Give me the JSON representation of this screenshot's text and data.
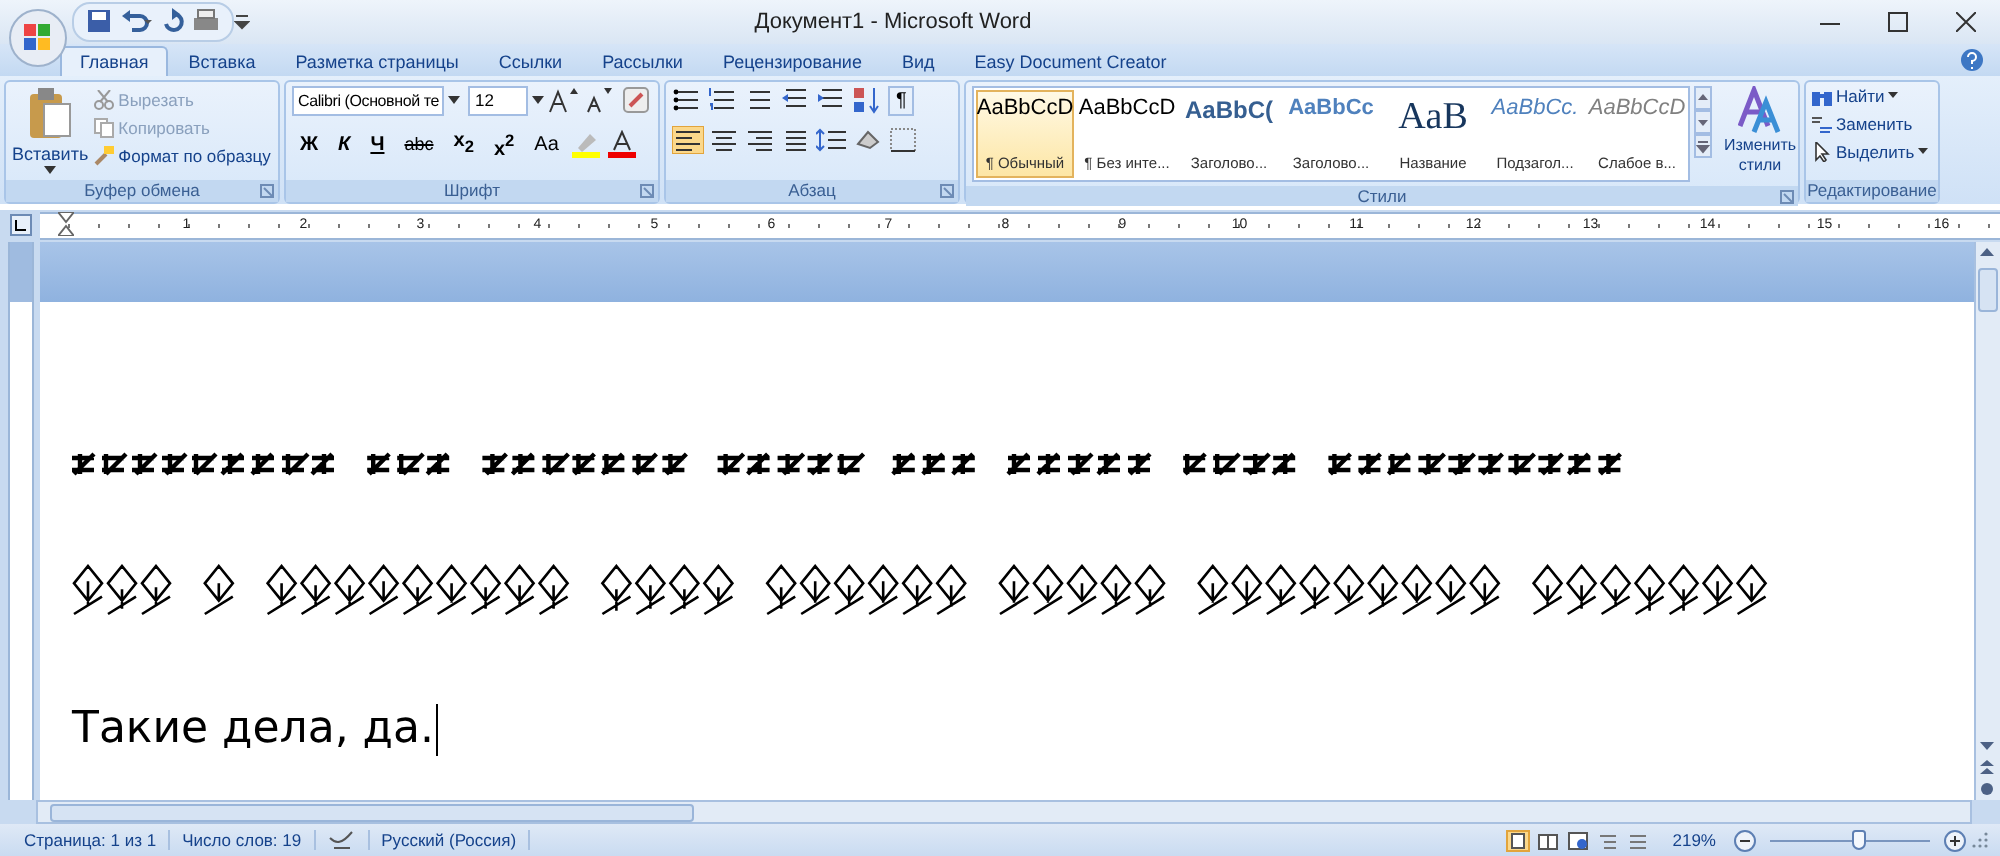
{
  "window": {
    "title": "Документ1 - Microsoft Word"
  },
  "tabs": [
    {
      "label": "Главная",
      "selected": true
    },
    {
      "label": "Вставка",
      "selected": false
    },
    {
      "label": "Разметка страницы",
      "selected": false
    },
    {
      "label": "Ссылки",
      "selected": false
    },
    {
      "label": "Рассылки",
      "selected": false
    },
    {
      "label": "Рецензирование",
      "selected": false
    },
    {
      "label": "Вид",
      "selected": false
    },
    {
      "label": "Easy Document Creator",
      "selected": false
    }
  ],
  "ribbon": {
    "clipboard": {
      "title": "Буфер обмена",
      "paste": "Вставить",
      "cut": "Вырезать",
      "copy": "Копировать",
      "format_painter": "Формат по образцу"
    },
    "font": {
      "title": "Шрифт",
      "font_name": "Calibri (Основной те",
      "font_size": "12",
      "bold": "Ж",
      "italic": "К",
      "underline": "Ч",
      "strike": "abc",
      "subscript": "x$_{2}$",
      "superscript": "x$^{2}$",
      "change_case": "Aa"
    },
    "paragraph": {
      "title": "Абзац",
      "pilcrow": "¶"
    },
    "styles": {
      "title": "Стили",
      "items": [
        {
          "sample": "AaBbCcD",
          "label": "¶ Обычный",
          "kind": "normal",
          "selected": true
        },
        {
          "sample": "AaBbCcD",
          "label": "¶ Без инте...",
          "kind": "normal",
          "selected": false
        },
        {
          "sample": "AaBbC(",
          "label": "Заголово...",
          "kind": "heading1",
          "selected": false
        },
        {
          "sample": "AaBbCc",
          "label": "Заголово...",
          "kind": "heading2",
          "selected": false
        },
        {
          "sample": "AaB",
          "label": "Название",
          "kind": "title",
          "selected": false
        },
        {
          "sample": "AaBbCc.",
          "label": "Подзагол...",
          "kind": "subtitle",
          "selected": false
        },
        {
          "sample": "AaBbCcD",
          "label": "Слабое в...",
          "kind": "subtle",
          "selected": false
        }
      ],
      "change_styles": "Изменить стили"
    },
    "editing": {
      "title": "Редактирование",
      "find": "Найти",
      "replace": "Заменить",
      "select": "Выделить"
    }
  },
  "ruler": {
    "marks": [
      "1",
      "2",
      "3",
      "4",
      "5",
      "6",
      "7",
      "8",
      "9",
      "10",
      "11",
      "12",
      "13",
      "14",
      "15",
      "16"
    ]
  },
  "document": {
    "paragraphs": [
      {
        "kind": "cipher"
      },
      {
        "kind": "cipher"
      },
      {
        "kind": "text",
        "text": "Такие дела, да."
      }
    ]
  },
  "status_bar": {
    "page": "Страница: 1 из 1",
    "words": "Число слов: 19",
    "language": "Русский (Россия)",
    "zoom": "219%",
    "zoom_slider": {
      "level": 0.55
    }
  }
}
